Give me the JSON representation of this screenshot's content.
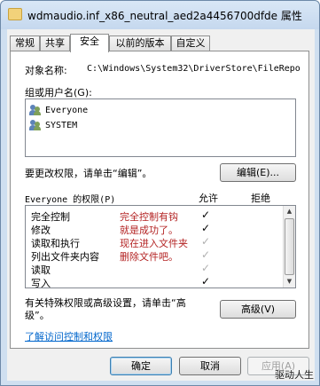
{
  "window": {
    "title": "wdmaudio.inf_x86_neutral_aed2a4456700dfde 属性"
  },
  "tabs": [
    {
      "label": "常规"
    },
    {
      "label": "共享"
    },
    {
      "label": "安全"
    },
    {
      "label": "以前的版本"
    },
    {
      "label": "自定义"
    }
  ],
  "active_tab": "安全",
  "object_name": {
    "label": "对象名称:",
    "value": "C:\\Windows\\System32\\DriverStore\\FileRepo"
  },
  "groups": {
    "label": "组或用户名(G):",
    "users": [
      {
        "name": "Everyone"
      },
      {
        "name": "SYSTEM"
      }
    ]
  },
  "change_perm_text": "要更改权限，请单击“编辑”。",
  "edit_button": "编辑(E)...",
  "permissions": {
    "label": "Everyone 的权限(P)",
    "allow_header": "允许",
    "deny_header": "拒绝",
    "rows": [
      {
        "name": "完全控制",
        "note": "完全控制有钩",
        "allow": "✓",
        "allow_state": "checked"
      },
      {
        "name": "修改",
        "note": "就是成功了。",
        "allow": "✓",
        "allow_state": "checked"
      },
      {
        "name": "读取和执行",
        "note": "现在进入文件夹",
        "allow": "✓",
        "allow_state": "grayed"
      },
      {
        "name": "列出文件夹内容",
        "note": "删除文件吧。",
        "allow": "✓",
        "allow_state": "grayed"
      },
      {
        "name": "读取",
        "note": "",
        "allow": "✓",
        "allow_state": "grayed"
      },
      {
        "name": "写入",
        "note": "",
        "allow": "✓",
        "allow_state": "checked"
      }
    ]
  },
  "special_text": "有关特殊权限或高级设置，请单击“高级”。",
  "advanced_button": "高级(V)",
  "learn_link": "了解访问控制和权限",
  "footer": {
    "ok": "确定",
    "cancel": "取消",
    "apply": "应用(A)"
  },
  "watermark": "驱动人生",
  "colors": {
    "note": "#b32222",
    "link": "#0066cc",
    "title_bg": "#cfdff0"
  }
}
